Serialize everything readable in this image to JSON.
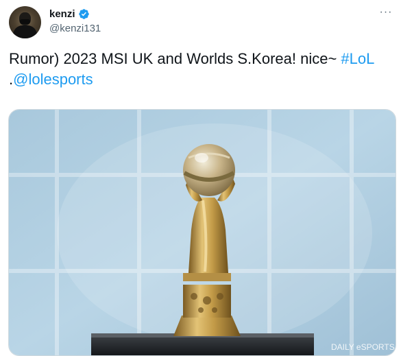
{
  "user": {
    "display_name": "kenzi",
    "handle": "@kenzi131",
    "verified": true,
    "avatar_icon": "profile-avatar"
  },
  "menu_icon": "more-options-icon",
  "tweet": {
    "text": "Rumor) 2023 MSI UK and Worlds S.Korea! nice~ ",
    "hashtag": "#LoL",
    "line2_prefix": ".",
    "mention": "@lolesports"
  },
  "media": {
    "watermark": "DAILY eSPORTS",
    "subject": "trophy-photo"
  },
  "colors": {
    "link": "#1d9bf0",
    "text": "#0f1419",
    "secondary": "#536471",
    "border": "#cfd9de"
  }
}
